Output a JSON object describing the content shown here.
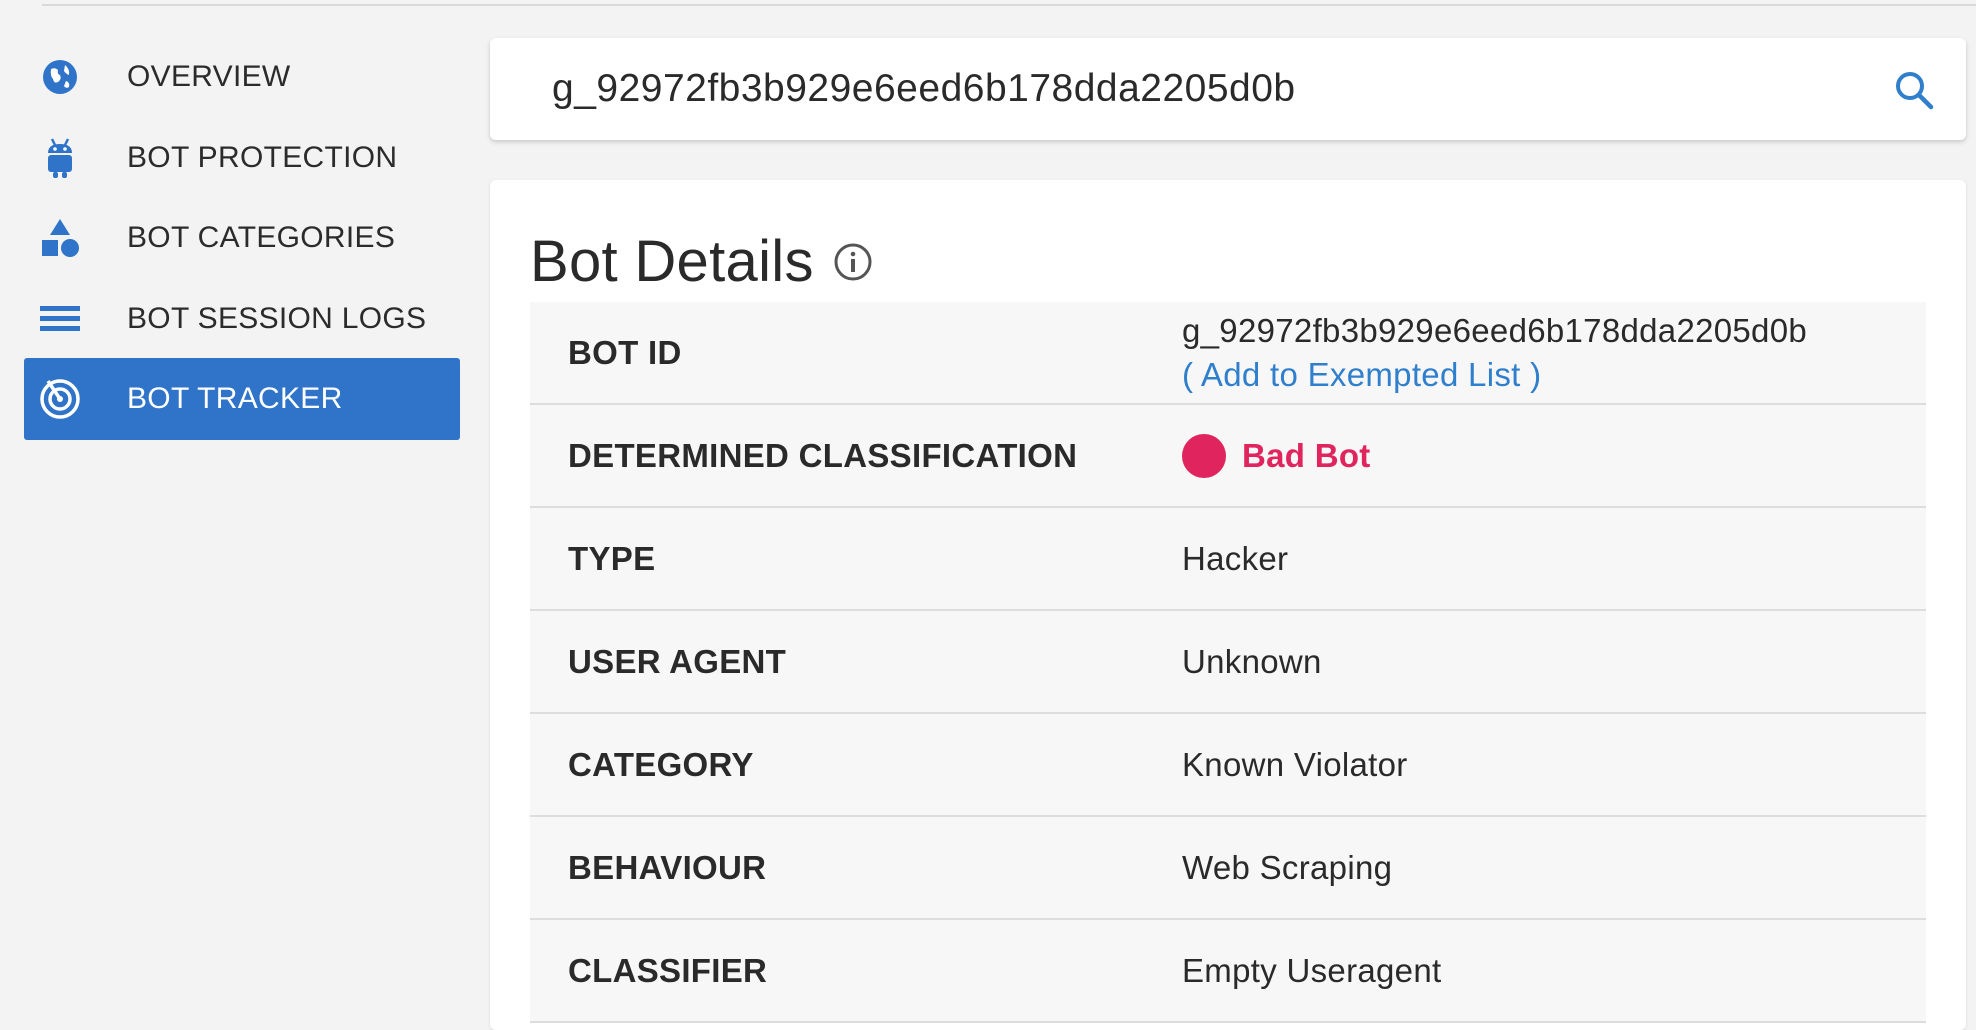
{
  "sidebar": {
    "items": [
      {
        "label": "OVERVIEW",
        "icon": "globe-icon"
      },
      {
        "label": "BOT PROTECTION",
        "icon": "android-bot-icon"
      },
      {
        "label": "BOT CATEGORIES",
        "icon": "shapes-icon"
      },
      {
        "label": "BOT SESSION LOGS",
        "icon": "list-icon"
      },
      {
        "label": "BOT TRACKER",
        "icon": "radar-icon",
        "active": true
      }
    ]
  },
  "search": {
    "value": "g_92972fb3b929e6eed6b178dda2205d0b",
    "icon": "search-icon"
  },
  "details": {
    "title": "Bot Details",
    "rows": [
      {
        "key": "BOT ID",
        "value": "g_92972fb3b929e6eed6b178dda2205d0b",
        "link": "( Add to Exempted List )"
      },
      {
        "key": "DETERMINED CLASSIFICATION",
        "value": "Bad Bot"
      },
      {
        "key": "TYPE",
        "value": "Hacker"
      },
      {
        "key": "USER AGENT",
        "value": "Unknown"
      },
      {
        "key": "CATEGORY",
        "value": "Known Violator"
      },
      {
        "key": "BEHAVIOUR",
        "value": "Web Scraping"
      },
      {
        "key": "CLASSIFIER",
        "value": "Empty Useragent"
      }
    ]
  },
  "colors": {
    "accent": "#2f74c8",
    "link": "#2f7fcd",
    "bad_bot": "#e0245e"
  }
}
